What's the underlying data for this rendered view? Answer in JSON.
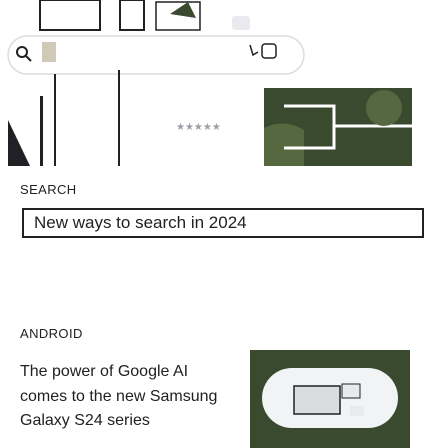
{
  "hero": {
    "stars": "★★★★★"
  },
  "articles": [
    {
      "category": "SEARCH",
      "title": "New ways to search in 2024"
    },
    {
      "category": "ANDROID",
      "title": "The power of Google AI comes to the new Samsung Galaxy S24 series"
    }
  ],
  "colors": {
    "border": "#202124",
    "text": "#202124",
    "illustration_dark": "#3a4a2e",
    "illustration_light": "#e8eaed"
  }
}
